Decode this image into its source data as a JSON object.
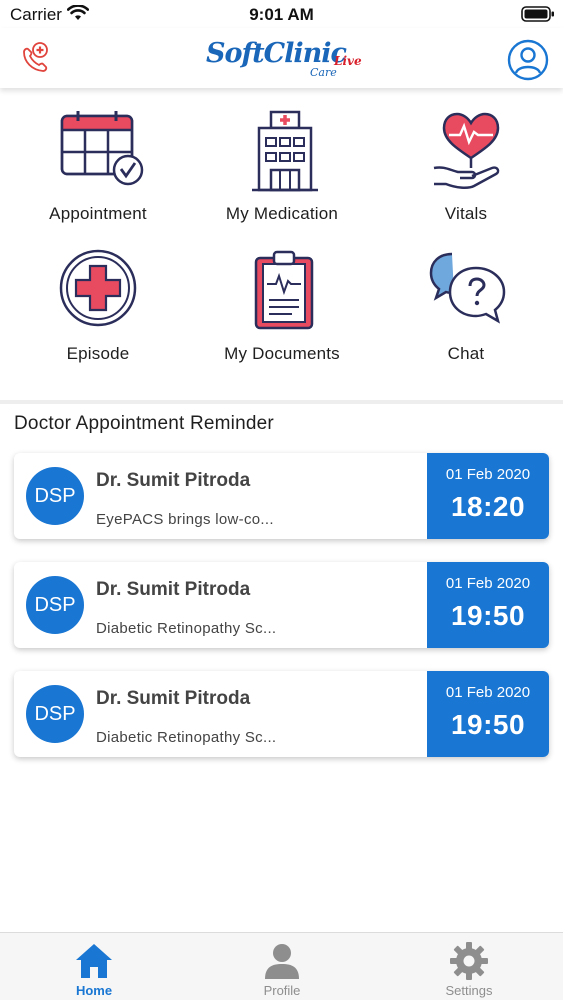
{
  "status_bar": {
    "carrier": "Carrier",
    "time": "9:01 AM"
  },
  "header": {
    "logo_main": "SoftClinic",
    "logo_live": "Live",
    "logo_care": "Care"
  },
  "menu": [
    {
      "label": "Appointment",
      "icon": "calendar-check-icon"
    },
    {
      "label": "My Medication",
      "icon": "hospital-icon"
    },
    {
      "label": "Vitals",
      "icon": "heart-hand-icon"
    },
    {
      "label": "Episode",
      "icon": "medical-cross-icon"
    },
    {
      "label": "My Documents",
      "icon": "clipboard-icon"
    },
    {
      "label": "Chat",
      "icon": "chat-bubbles-icon"
    }
  ],
  "reminders": {
    "title": "Doctor Appointment Reminder",
    "items": [
      {
        "initials": "DSP",
        "doctor": "Dr. Sumit Pitroda",
        "description": "EyePACS brings low-co...",
        "date": "01 Feb 2020",
        "time": "18:20"
      },
      {
        "initials": "DSP",
        "doctor": "Dr. Sumit Pitroda",
        "description": "Diabetic Retinopathy Sc...",
        "date": "01 Feb 2020",
        "time": "19:50"
      },
      {
        "initials": "DSP",
        "doctor": "Dr. Sumit Pitroda",
        "description": "Diabetic Retinopathy Sc...",
        "date": "01 Feb 2020",
        "time": "19:50"
      }
    ]
  },
  "tab_bar": {
    "tabs": [
      {
        "label": "Home",
        "icon": "home-icon",
        "active": true
      },
      {
        "label": "Profile",
        "icon": "person-icon",
        "active": false
      },
      {
        "label": "Settings",
        "icon": "gear-icon",
        "active": false
      }
    ]
  },
  "colors": {
    "primary": "#1976d2",
    "logo_blue": "#1a66b8",
    "accent_red": "#e84a5f",
    "icon_navy": "#2b2d5a"
  }
}
